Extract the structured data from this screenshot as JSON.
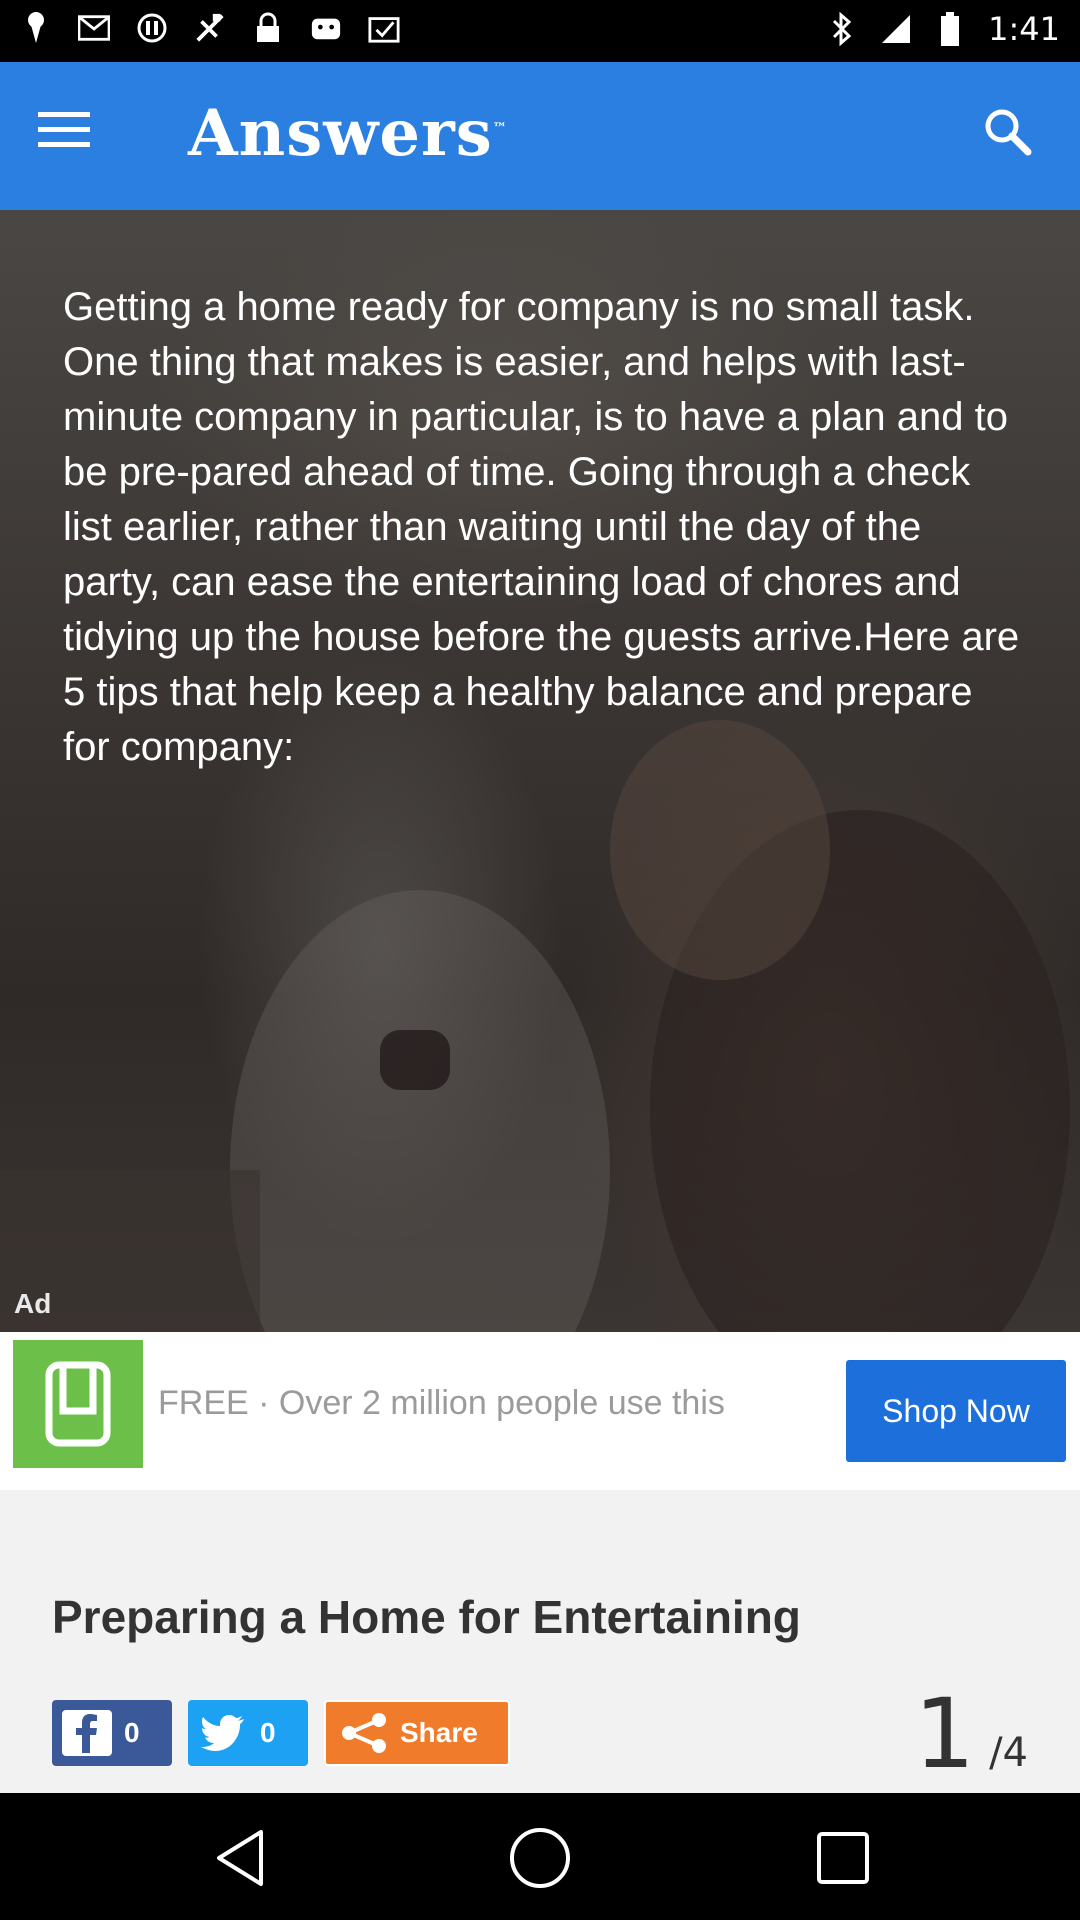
{
  "status_bar": {
    "time": "1:41",
    "left_icons": [
      "notification-icon",
      "gmail-icon",
      "alert-icon",
      "fake-gps-icon",
      "lock-icon",
      "android-icon",
      "clipboard-check-icon"
    ],
    "right_icons": [
      "bluetooth-icon",
      "signal-icon",
      "battery-icon"
    ]
  },
  "app_bar": {
    "logo_text": "Answers",
    "logo_tm": "™",
    "menu_icon": "hamburger-menu-icon",
    "search_icon": "search-icon",
    "color": "#2b7fe0"
  },
  "hero": {
    "text": "Getting a home ready for company is no small task. One thing that makes is easier, and helps with last-minute company in particular, is to have a plan and to be pre-pared ahead of time. Going through a check list earlier, rather than waiting until the day of the party, can ease the entertaining load of chores and tidying up the house before the guests arrive.Here are 5 tips that help keep a healthy balance and prepare for company:"
  },
  "ad": {
    "label": "Ad",
    "text": "FREE · Over 2 million people use this",
    "button": "Shop Now",
    "logo_icon": "grocery-app-logo-icon",
    "logo_color": "#6cc04a",
    "button_color": "#1d6fdc"
  },
  "article": {
    "title": "Preparing a Home for Entertaining",
    "facebook_count": "0",
    "twitter_count": "0",
    "share_label": "Share",
    "page_current": "1",
    "page_total": "/4"
  },
  "nav_bar": {
    "back_icon": "back-icon",
    "home_icon": "home-icon",
    "recents_icon": "recents-icon"
  }
}
